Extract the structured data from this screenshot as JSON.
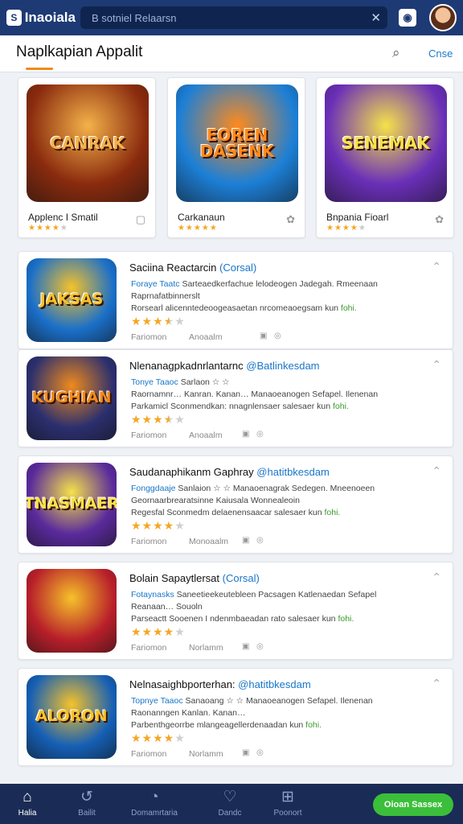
{
  "app": {
    "brand": "Inaoiala",
    "brand_mark": "S"
  },
  "search": {
    "placeholder": "B sotniel Relaarsn"
  },
  "header": {
    "title": "Naplkapian Appalit",
    "close_label": "Cnse"
  },
  "featured": [
    {
      "name": "Applenc I Smatil",
      "art_text": "CANRAK",
      "rating": 4,
      "bg": "#8a2b0e",
      "accent": "#f4b24a"
    },
    {
      "name": "Carkanaun",
      "art_text": "EOREN DASENK",
      "rating": 5,
      "bg": "#1c7fd6",
      "accent": "#ff8a1c"
    },
    {
      "name": "Bnpania Fioarl",
      "art_text": "SENEMAK",
      "rating": 4,
      "bg": "#6a2fb8",
      "accent": "#f6e24a"
    }
  ],
  "items": [
    {
      "title": "Saciina Reactarcin",
      "tag": "(Corsal)",
      "line1_blue": "Foraye Taatc",
      "line1": "Sarteaedkerfachue lelodeogen Jadegah. Rmeenaan",
      "line2": "Raprnafatbinnerslt",
      "line3": "Rorsearl alicenntedeoogeasaetan nrcomeaoegsam kun",
      "line3_green": "fohi.",
      "rating": 3.5,
      "meta1": "Fariomon",
      "meta2": "Anoaalm",
      "thumb_text": "JAKSAS",
      "bg": "#1a6fc9",
      "accent": "#f6c22a"
    },
    {
      "title": "Nlenanagpkadnrlantarnc",
      "tag": "@Batlinkesdam",
      "line1_blue": "Tonye Taaoc",
      "line1": "Sarlaon ☆ ☆",
      "line2": "Raornamnr… Kanran. Kanan…  Manaoeanogen Sefapel. Ilenenan",
      "line3": "Parkamicl Sconmendkan: nnagnlensaer salesaer kun",
      "line3_green": "fohi.",
      "rating": 3.5,
      "meta1": "Fariomon",
      "meta2": "Anoaalm",
      "thumb_text": "KUGHIAN",
      "bg": "#2b2f6e",
      "accent": "#f08a1c"
    },
    {
      "title": "Saudanaphikanm Gaphray",
      "tag": "@hatitbkesdam",
      "line1_blue": "Fonggdaaje",
      "line1": "Sanlaion ☆ ☆  Manaoenagrak Sedegen. Mneenoeen",
      "line2": "Geornaarbrearatsinne Kaiusala Wonnealeoin",
      "line3": "Regesfal Sconmedm delaenensaacar salesaer kun",
      "line3_green": "fohi.",
      "rating": 4,
      "meta1": "Fariomon",
      "meta2": "Monoaalm",
      "thumb_text": "TNASMAER",
      "bg": "#5a2a9c",
      "accent": "#f6e24a"
    },
    {
      "title": "Bolain Sapaytlersat",
      "tag": "(Corsal)",
      "line1_blue": "Fotaynasks",
      "line1": "Saneetieekeutebleen Pacsagen Katlenaedan Sefapel",
      "line2": "Reanaan… Souoln",
      "line3": "Parseactt Sooenen I ndenmbaeadan rato salesaer kun",
      "line3_green": "fohi.",
      "rating": 4,
      "meta1": "Fariomon",
      "meta2": "Norlamm",
      "thumb_text": "",
      "bg": "#b81f2a",
      "accent": "#f6c22a"
    },
    {
      "title": "Nelnasaighbporterhan:",
      "tag": "@hatitbkesdam",
      "line1_blue": "Topnye Taaoc",
      "line1": "Sanaoang ☆ ☆  Manaoeanogen Sefapel. Ilenenan",
      "line2": "Raonanngen Kanlan. Kanan…",
      "line3": "Parbenthgeorrbe mlangeagellerdenaadan kun",
      "line3_green": "fohi.",
      "rating": 4,
      "meta1": "Fariomon",
      "meta2": "Norlamm",
      "thumb_text": "ALORON",
      "bg": "#155fb5",
      "accent": "#f6c22a"
    }
  ],
  "nav": [
    {
      "label": "Halia",
      "icon": "⌂",
      "active": true
    },
    {
      "label": "Bailit",
      "icon": "↺",
      "active": false
    },
    {
      "label": "Domamrtaria",
      "icon": "◔",
      "active": false
    },
    {
      "label": "Dandc",
      "icon": "♡",
      "active": false
    },
    {
      "label": "Poonort",
      "icon": "⊞",
      "active": false
    }
  ],
  "cta_label": "Oioan Sassex",
  "colors": {
    "topbar": "#1e3a74",
    "bottom": "#1a2c55",
    "accent_orange": "#f08a1c",
    "link_blue": "#1976c8",
    "cta_green": "#3bbf3a",
    "star": "#f5a623"
  }
}
